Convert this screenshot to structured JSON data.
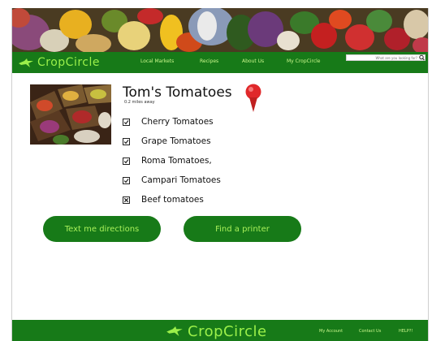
{
  "brand": {
    "name": "CropCircle"
  },
  "nav": {
    "links": [
      "Local Markets",
      "Recipes",
      "About Us",
      "My CropCircle"
    ],
    "search_placeholder": "What are you looking for?"
  },
  "market": {
    "title": "Tom's Tomatoes",
    "distance": "0.2 miles away",
    "items": [
      {
        "label": "Cherry Tomatoes",
        "state": "checked"
      },
      {
        "label": "Grape Tomatoes",
        "state": "checked"
      },
      {
        "label": "Roma Tomatoes,",
        "state": "checked"
      },
      {
        "label": "Campari Tomatoes",
        "state": "checked"
      },
      {
        "label": "Beef tomatoes",
        "state": "unavailable"
      }
    ]
  },
  "actions": {
    "directions": "Text me directions",
    "printer": "Find a printer"
  },
  "footer": {
    "links": [
      "My Account",
      "Contact Us",
      "HELP?!"
    ]
  },
  "colors": {
    "brand_green": "#177a18",
    "logo_green": "#9bf04a",
    "pin_red": "#e0282a"
  }
}
